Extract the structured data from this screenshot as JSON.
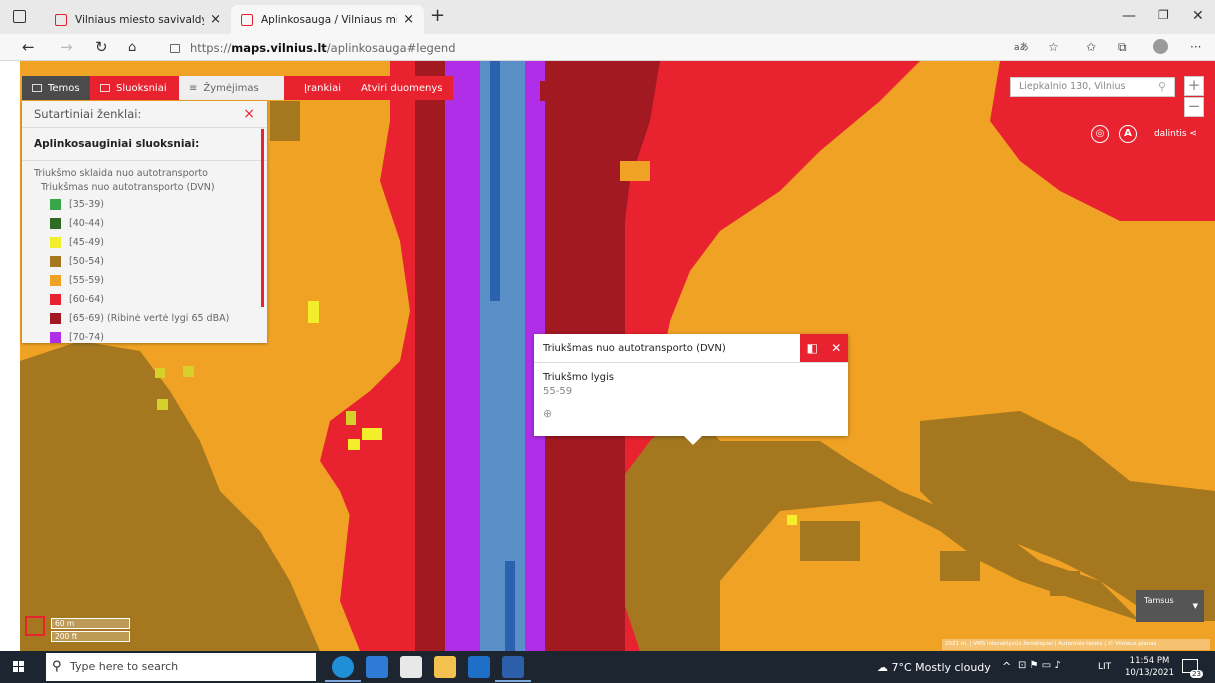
{
  "browser": {
    "tabs": [
      {
        "title": "Vilniaus miesto savivaldybe",
        "active": false
      },
      {
        "title": "Aplinkosauga / Vilniaus miesto s",
        "active": true
      }
    ],
    "url_prefix": "https://",
    "url_domain": "maps.vilnius.lt",
    "url_path": "/aplinkosauga#legend"
  },
  "toolbar": {
    "temos": "Temos",
    "sluoksniai": "Sluoksniai",
    "zymejimas": "Žymėjimas",
    "irankiai": "Įrankiai",
    "atviri": "Atviri duomenys"
  },
  "legend": {
    "title": "Sutartiniai ženklai:",
    "section": "Aplinkosauginiai sluoksniai:",
    "group": "Triukšmo sklaida nuo autotransporto",
    "layer": "Triukšmas nuo autotransporto (DVN)",
    "items": [
      {
        "label": "[35-39)",
        "color": "#3aa64a"
      },
      {
        "label": "[40-44)",
        "color": "#2f6b25"
      },
      {
        "label": "[45-49)",
        "color": "#f2ee2c"
      },
      {
        "label": "[50-54)",
        "color": "#a5781f"
      },
      {
        "label": "[55-59)",
        "color": "#f0a225"
      },
      {
        "label": "[60-64)",
        "color": "#e8232f"
      },
      {
        "label": "[65-69) (Ribinė vertė lygi 65 dBA)",
        "color": "#a31922"
      },
      {
        "label": "[70-74)",
        "color": "#b02ee8"
      }
    ]
  },
  "search": {
    "placeholder": "Liepkalnio 130, Vilnius"
  },
  "map_controls": {
    "zoom_in": "+",
    "zoom_out": "−",
    "locate": "◎",
    "a_button": "A",
    "share": "dalintis"
  },
  "popup": {
    "title": "Triukšmas nuo autotransporto (DVN)",
    "field_label": "Triukšmo lygis",
    "field_value": "55-59"
  },
  "scale": {
    "metric": "60 m",
    "imperial": "200 ft"
  },
  "basemap": {
    "label": "Tamsus"
  },
  "credits": "2021 m. | VMS interaktyvūs žemėlapiai | Autorinės teisės | © Vilniaus planas",
  "taskbar": {
    "search_placeholder": "Type here to search",
    "weather": "7°C  Mostly cloudy",
    "lang": "LIT",
    "time": "11:54 PM",
    "date": "10/13/2021",
    "notifications": "23"
  },
  "colors": {
    "brand_red": "#e8232f",
    "noise_50_54": "#a5781f",
    "noise_55_59": "#f0a225",
    "noise_60_64": "#e8232f",
    "noise_65_69": "#a31922",
    "noise_70_74": "#b02ee8",
    "road_blue": "#5a8fc7"
  }
}
